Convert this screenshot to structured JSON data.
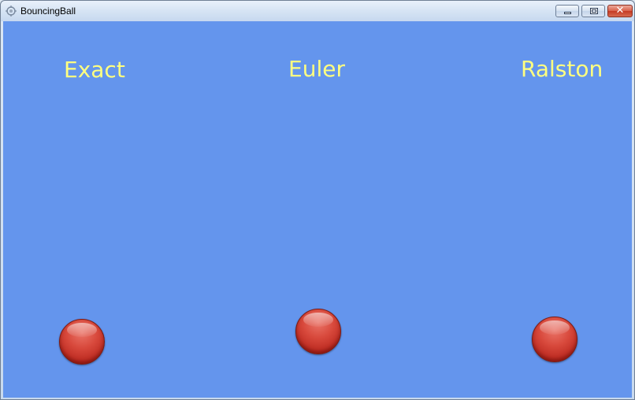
{
  "window": {
    "title": "BouncingBall",
    "close_glyph": "✕"
  },
  "labels": {
    "exact": "Exact",
    "euler": "Euler",
    "ralston": "Ralston"
  },
  "colors": {
    "background": "#6495ed",
    "label": "#ffff80",
    "ball": "#d8493c"
  },
  "icons": {
    "app": "app-icon",
    "minimize": "minimize-icon",
    "maximize": "maximize-icon",
    "close": "close-icon"
  }
}
